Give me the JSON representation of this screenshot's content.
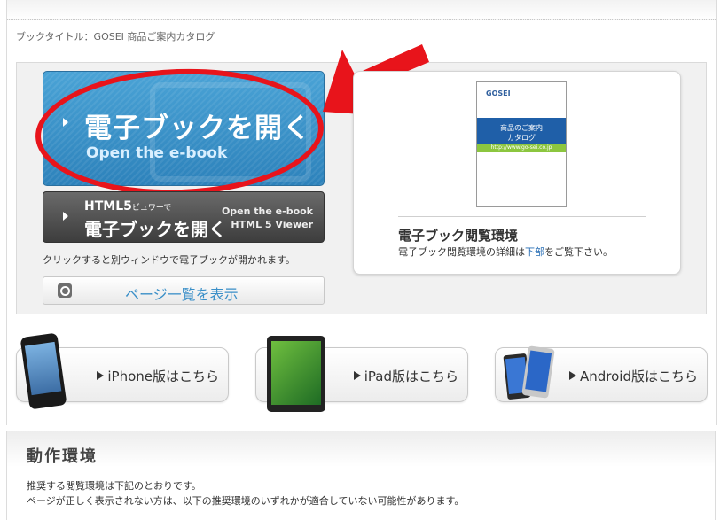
{
  "book_title": "ブックタイトル：GOSEI 商品ご案内カタログ",
  "open_button": {
    "jp": "電子ブックを開く",
    "en": "Open the e-book"
  },
  "html5_button": {
    "line1": "HTML5",
    "line1_small": "ビュワーで",
    "line2": "電子ブックを開く",
    "right1": "Open the e-book",
    "right2": "HTML 5 Viewer"
  },
  "new_window_note": "クリックすると別ウィンドウで電子ブックが開かれます。",
  "page_list_button": "ページ一覧を表示",
  "cover": {
    "logo": "GOSEI",
    "line1": "商品のご案内",
    "line2": "カタログ",
    "url": "http://www.go-sei.co.jp"
  },
  "env": {
    "title": "電子ブック閲覧環境",
    "note_pre": "電子ブック閲覧環境の詳細は",
    "note_link": "下部",
    "note_post": "をご覧下さい。"
  },
  "devices": {
    "iphone": "iPhone版はこちら",
    "ipad": "iPad版はこちら",
    "android": "Android版はこちら"
  },
  "section": {
    "title": "動作環境",
    "p1": "推奨する閲覧環境は下記のとおりです。",
    "p2": "ページが正しく表示されない方は、以下の推奨環境のいずれかが適合していない可能性があります。"
  },
  "colors": {
    "accent_blue": "#2d82bb",
    "annotation_red": "#e8141b",
    "link_blue": "#2a6fb5"
  }
}
